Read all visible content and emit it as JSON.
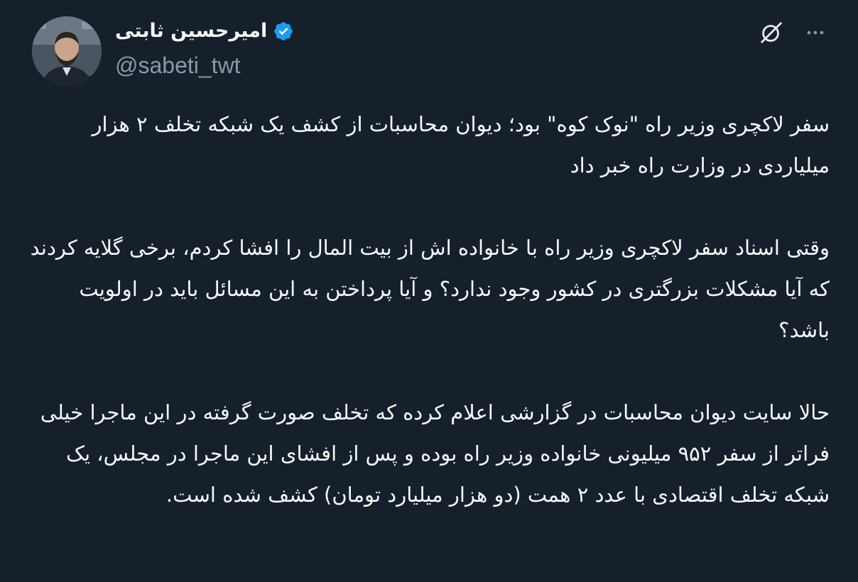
{
  "author": {
    "display_name": "امیرحسین ثابتی",
    "handle": "@sabeti_twt",
    "verified_badge_color": "#1d9bf0",
    "avatar_icon": "profile-photo"
  },
  "toolbar": {
    "grok_icon": "grok-icon",
    "more_icon": "more-options-icon"
  },
  "tweet": {
    "paragraphs": [
      "سفر لاکچری وزیر راه \"نوک کوه\" بود؛ دیوان محاسبات از کشف یک شبکه تخلف ۲ هزار میلیاردی در وزارت راه خبر داد",
      "وقتی اسناد سفر لاکچری وزیر راه با خانواده اش از بیت المال را افشا کردم، برخی گلایه کردند که آیا مشکلات بزرگتری در کشور وجود ندارد؟ و آیا پرداختن به این مسائل باید در اولویت باشد؟",
      "حالا سایت دیوان محاسبات در گزارشی اعلام کرده که تخلف صورت گرفته در این ماجرا خیلی فراتر از سفر ۹۵۲ میلیونی خانواده وزیر راه بوده و پس از افشای این ماجرا در مجلس، یک شبکه تخلف اقتصادی با عدد ۲ همت (دو هزار میلیارد تومان) کشف شده است."
    ]
  },
  "colors": {
    "background": "#15202b",
    "text": "#f7f9f9",
    "secondary_text": "#8b98a5"
  }
}
